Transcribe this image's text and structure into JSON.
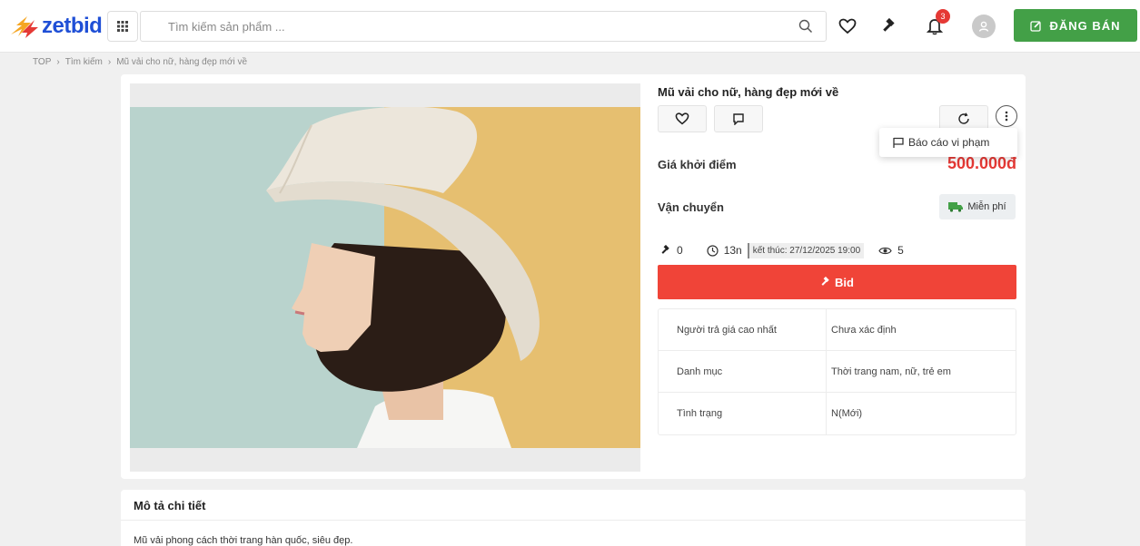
{
  "header": {
    "logo_text": "zetbid",
    "search_placeholder": "Tìm kiếm sản phẩm ...",
    "notification_count": "3",
    "sell_label": "ĐĂNG BÁN",
    "brand_color": "#1f4fd6",
    "sell_color": "#43a047"
  },
  "breadcrumb": {
    "items": [
      "TOP",
      "Tìm kiếm",
      "Mũ vải cho nữ, hàng đẹp mới về"
    ]
  },
  "product": {
    "title": "Mũ vải cho nữ, hàng đẹp mới về",
    "menu_item": "Báo cáo vi phạm",
    "price_label": "Giá khởi điểm",
    "price": "500.000đ",
    "shipping_label": "Vận chuyển",
    "shipping_value": "Miễn phí",
    "bid_count": "0",
    "time_left": "13n",
    "end_time": "kết thúc: 27/12/2025 19:00",
    "views": "5",
    "bid_label": "Bid",
    "accent_color": "#f04438",
    "info": [
      {
        "key": "Người trả giá cao nhất",
        "value": "Chưa xác định"
      },
      {
        "key": "Danh mục",
        "value": "Thời trang nam, nữ, trẻ em"
      },
      {
        "key": "Tình trạng",
        "value": "N(Mới)"
      }
    ]
  },
  "description": {
    "heading": "Mô tả chi tiết",
    "text": "Mũ vải phong cách thời trang hàn quốc, siêu đẹp."
  }
}
